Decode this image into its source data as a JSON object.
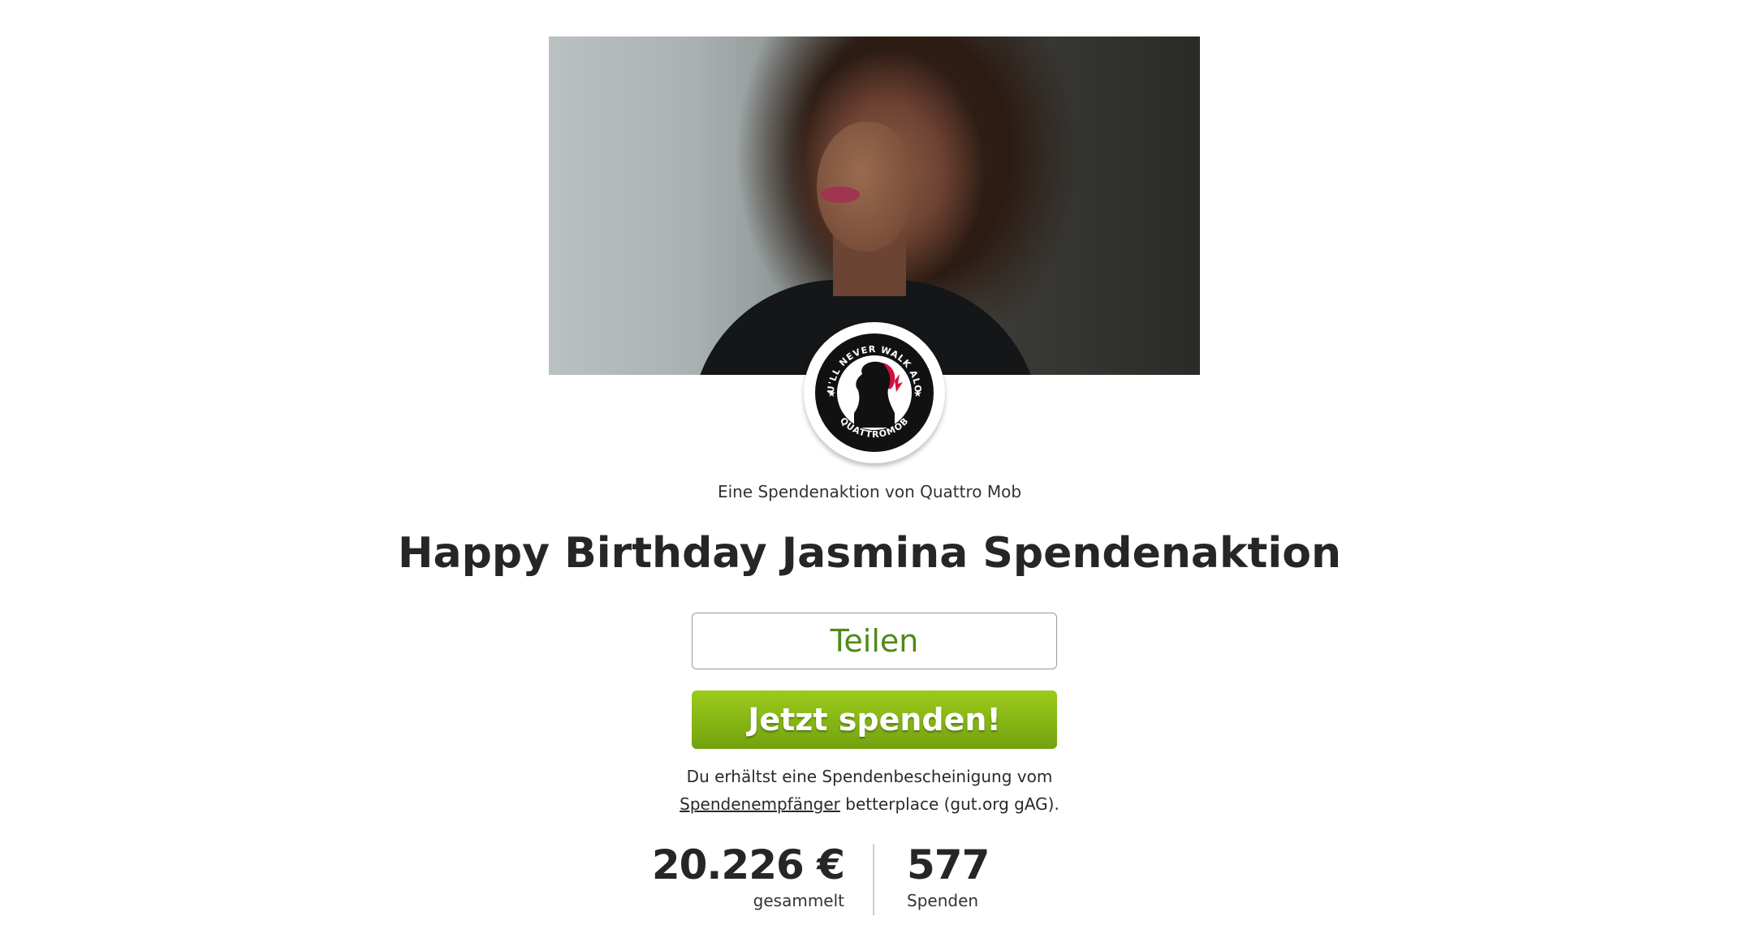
{
  "hero": {
    "image": "campaign-cover-photo"
  },
  "organizer": {
    "logo": "quattro-mob-logo",
    "logo_text_top": "YOU'LL NEVER WALK ALONE",
    "logo_text_bottom": "QUATTROMOB",
    "byline": "Eine Spendenaktion von Quattro Mob"
  },
  "campaign": {
    "title": "Happy Birthday Jasmina Spendenaktion"
  },
  "actions": {
    "share_label": "Teilen",
    "donate_label": "Jetzt spenden!"
  },
  "notice": {
    "line1": "Du erhältst eine Spendenbescheinigung vom",
    "link_text": "Spendenempfänger",
    "line2_rest": " betterplace (gut.org gAG)."
  },
  "stats": {
    "amount": "20.226 €",
    "amount_label": "gesammelt",
    "donations": "577",
    "donations_label": "Spenden"
  },
  "colors": {
    "accent_green": "#85b515",
    "share_text_green": "#4f8a18",
    "text_dark": "#262626"
  }
}
